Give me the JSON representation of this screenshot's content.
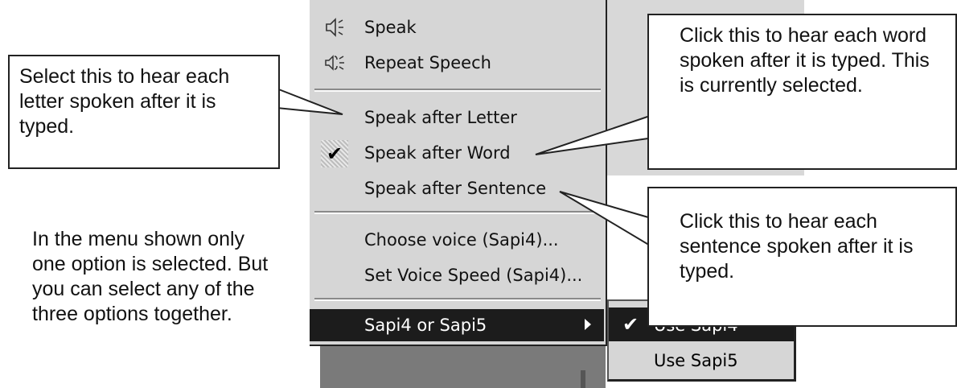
{
  "menu": {
    "items": [
      {
        "label": "Speak",
        "icon": "speaker-icon"
      },
      {
        "label": "Repeat Speech",
        "icon": "speaker-repeat-icon"
      },
      {
        "label": "Speak after Letter",
        "checked": false
      },
      {
        "label": "Speak after Word",
        "checked": true
      },
      {
        "label": "Speak after Sentence",
        "checked": false
      },
      {
        "label": "Choose voice (Sapi4)..."
      },
      {
        "label": "Set Voice Speed (Sapi4)..."
      },
      {
        "label": "Sapi4 or Sapi5",
        "submenu": true,
        "highlighted": true
      }
    ]
  },
  "submenu": {
    "items": [
      {
        "label": "Use Sapi4",
        "checked": true,
        "highlighted": true
      },
      {
        "label": "Use Sapi5",
        "checked": false
      }
    ]
  },
  "callouts": {
    "letter": "Select this to hear each letter spoken after it is typed.",
    "word": "Click this to hear each word spoken after it is typed. This is currently selected.",
    "sentence": "Click this to hear each sentence spoken after it is typed.",
    "note": "In the menu shown only one option is selected. But you can select any of the three options together."
  },
  "icons": {
    "check": "✔",
    "submenu_arrow": "▶"
  }
}
